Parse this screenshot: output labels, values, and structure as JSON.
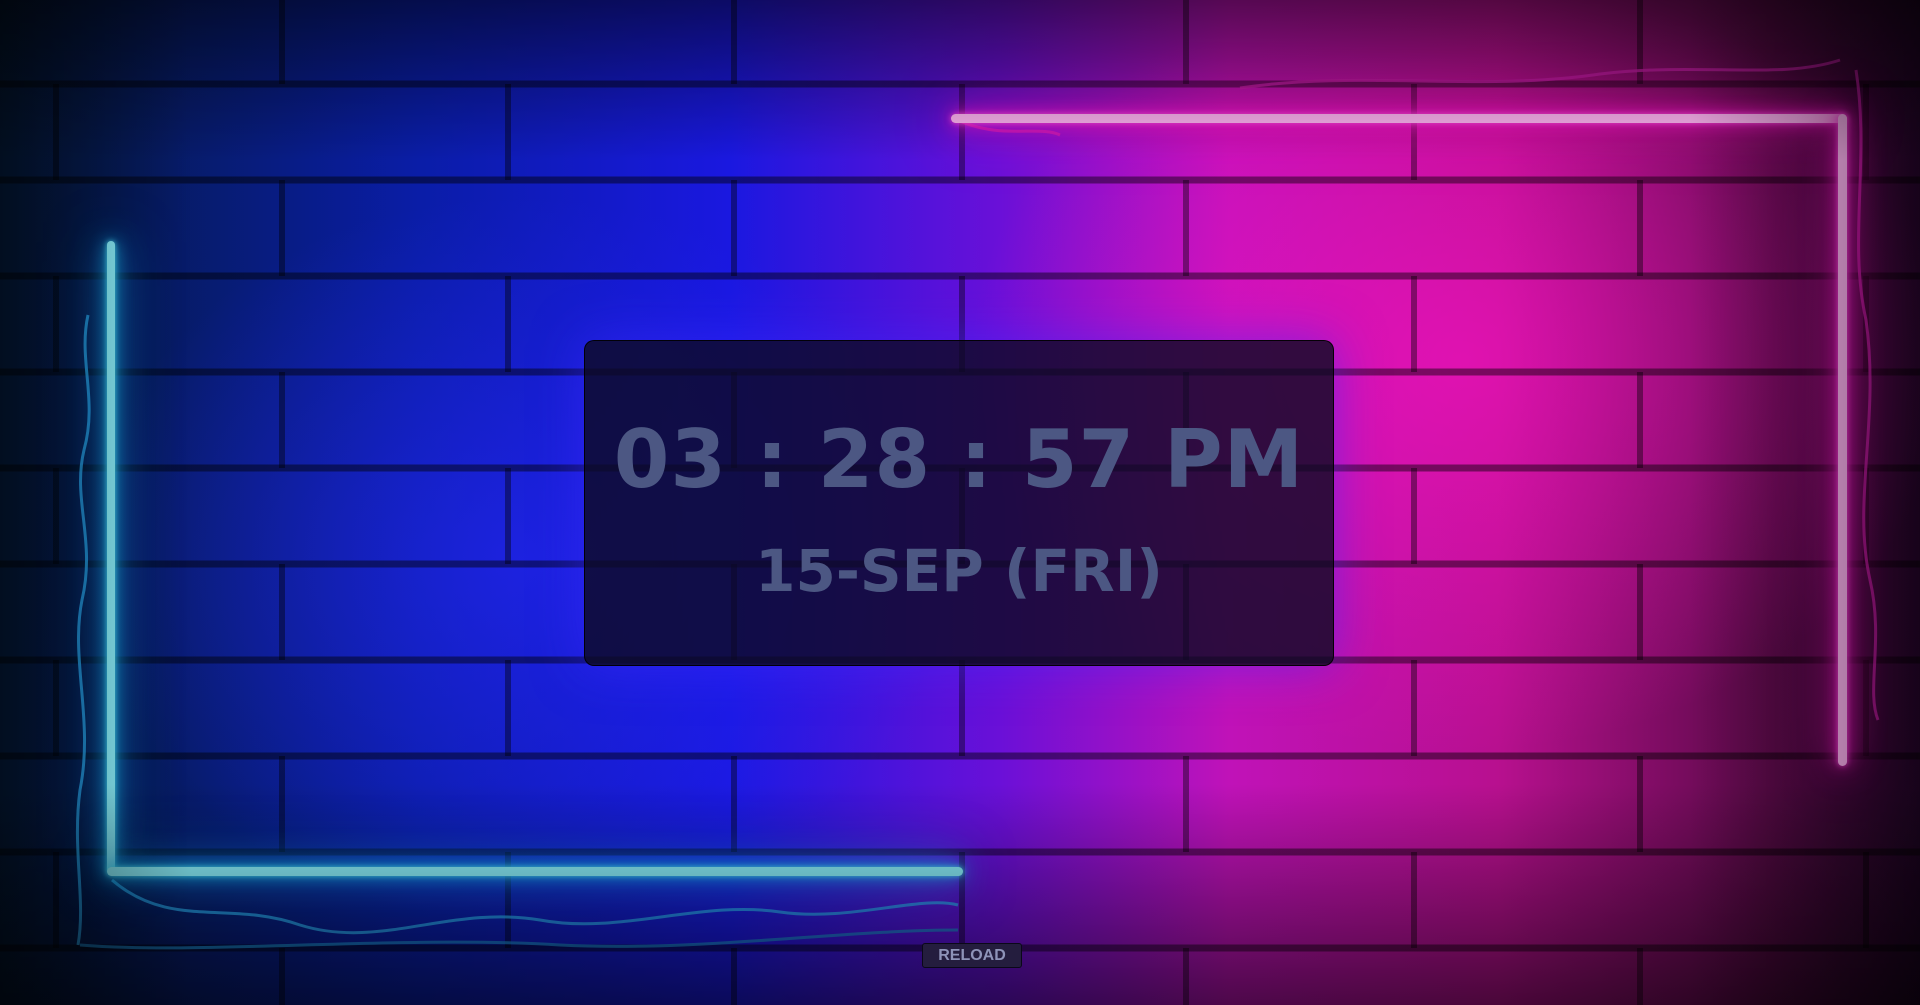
{
  "clock": {
    "time": "03 : 28 : 57 PM",
    "date": "15-SEP (FRI)"
  },
  "controls": {
    "reload_label": "RELOAD"
  },
  "colors": {
    "neon_left": "#19c8ff",
    "neon_right": "#ff1ad2",
    "clock_text": "#4c5783",
    "panel_bg": "#0e0a24"
  }
}
